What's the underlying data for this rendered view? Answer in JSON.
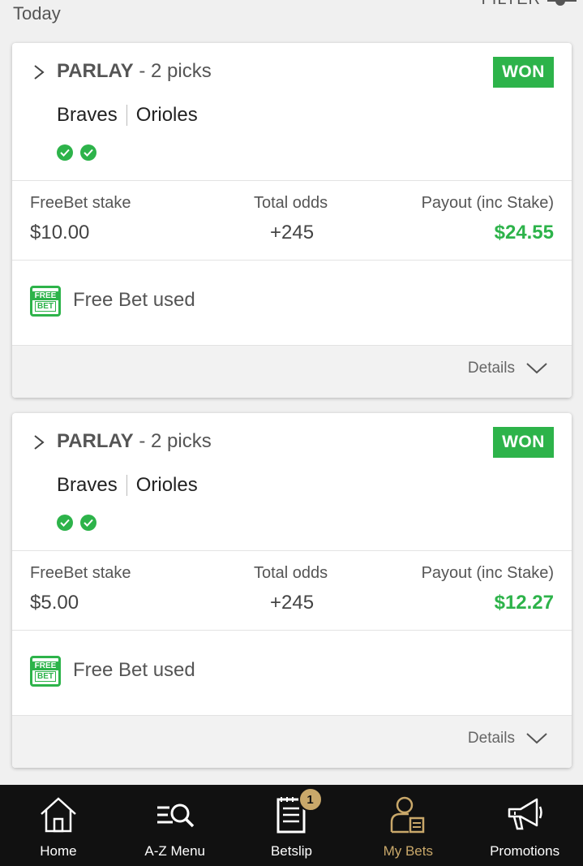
{
  "header": {
    "section_label": "Today",
    "filter_label": "FILTER"
  },
  "bets": [
    {
      "type": "PARLAY",
      "picks_text": " - 2 picks",
      "status": "WON",
      "teams": [
        "Braves",
        "Orioles"
      ],
      "pick_results": [
        "won",
        "won"
      ],
      "stake_label": "FreeBet stake",
      "stake_value": "$10.00",
      "odds_label": "Total odds",
      "odds_value": "+245",
      "payout_label": "Payout (inc Stake)",
      "payout_value": "$24.55",
      "free_bet_icon": {
        "line1": "FREE",
        "line2": "BET"
      },
      "free_bet_text": "Free Bet used",
      "details_label": "Details"
    },
    {
      "type": "PARLAY",
      "picks_text": " - 2 picks",
      "status": "WON",
      "teams": [
        "Braves",
        "Orioles"
      ],
      "pick_results": [
        "won",
        "won"
      ],
      "stake_label": "FreeBet stake",
      "stake_value": "$5.00",
      "odds_label": "Total odds",
      "odds_value": "+245",
      "payout_label": "Payout (inc Stake)",
      "payout_value": "$12.27",
      "free_bet_icon": {
        "line1": "FREE",
        "line2": "BET"
      },
      "free_bet_text": "Free Bet used",
      "details_label": "Details"
    }
  ],
  "nav": [
    {
      "label": "Home",
      "icon": "home-icon"
    },
    {
      "label": "A-Z Menu",
      "icon": "az-menu-icon"
    },
    {
      "label": "Betslip",
      "icon": "betslip-icon",
      "badge": "1"
    },
    {
      "label": "My Bets",
      "icon": "my-bets-icon",
      "active": true
    },
    {
      "label": "Promotions",
      "icon": "megaphone-icon"
    }
  ],
  "colors": {
    "win_green": "#2db34a",
    "nav_bg": "#111111",
    "accent_gold": "#c9a86a"
  }
}
